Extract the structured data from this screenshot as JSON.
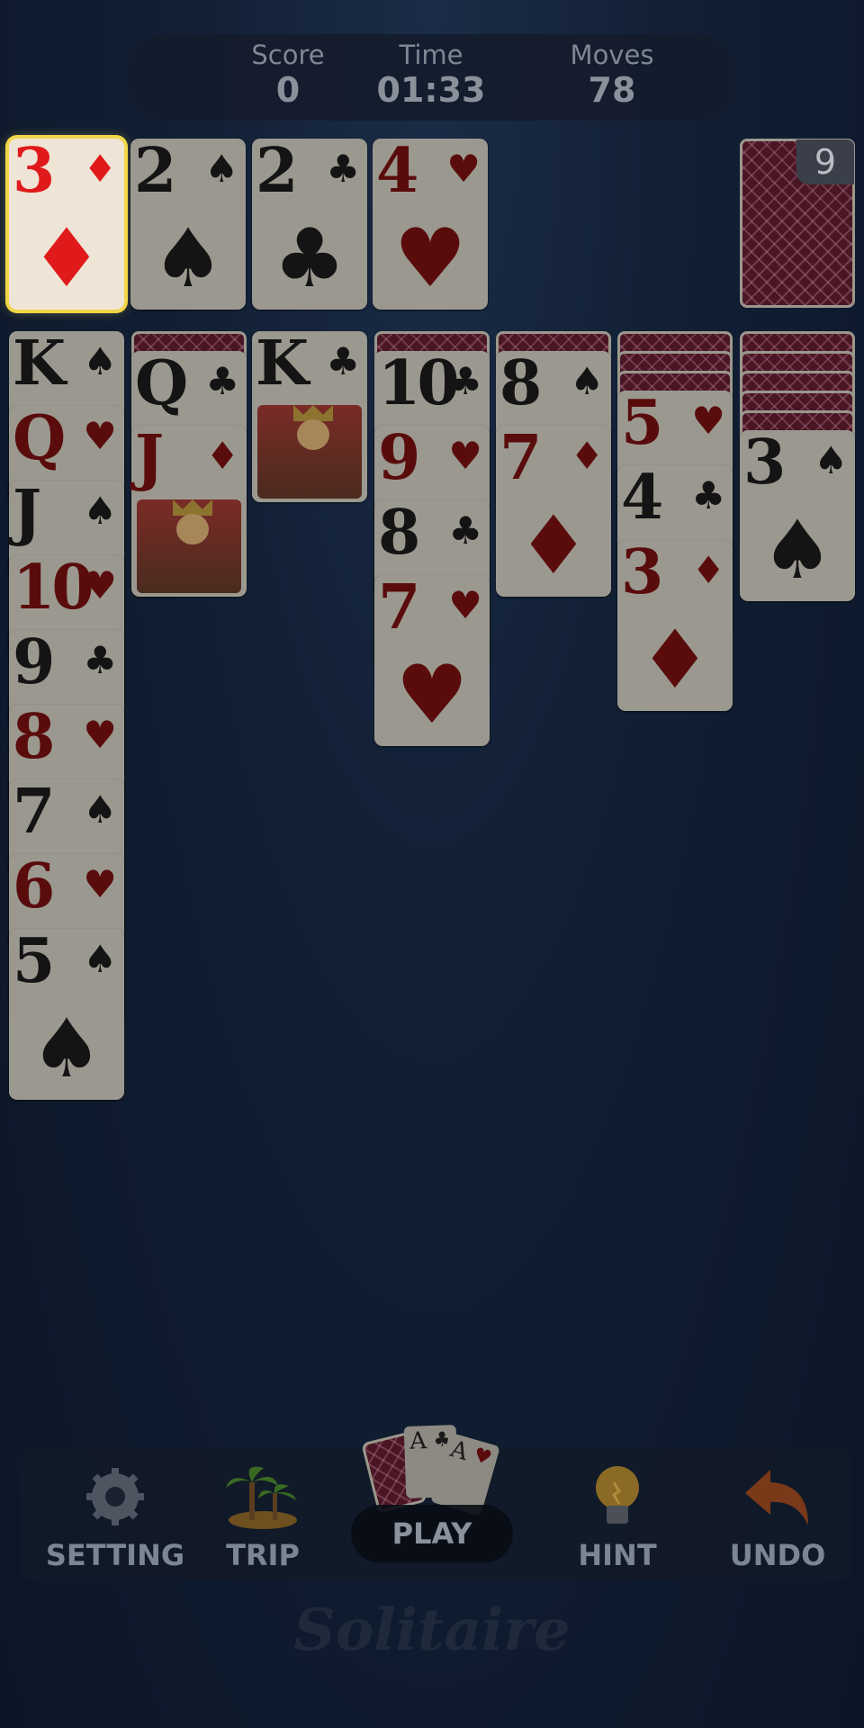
{
  "hud": {
    "score_label": "Score",
    "score_value": "0",
    "time_label": "Time",
    "time_value": "01:33",
    "moves_label": "Moves",
    "moves_value": "78"
  },
  "stock": {
    "count": "9"
  },
  "foundation": [
    {
      "rank": "3",
      "suit": "♦",
      "color": "red",
      "highlighted": true
    },
    {
      "rank": "2",
      "suit": "♠",
      "color": "black"
    },
    {
      "rank": "2",
      "suit": "♣",
      "color": "black"
    },
    {
      "rank": "4",
      "suit": "♥",
      "color": "red"
    }
  ],
  "tableau": [
    {
      "hidden": 0,
      "cards": [
        {
          "rank": "K",
          "suit": "♠",
          "color": "black"
        },
        {
          "rank": "Q",
          "suit": "♥",
          "color": "red"
        },
        {
          "rank": "J",
          "suit": "♠",
          "color": "black"
        },
        {
          "rank": "10",
          "suit": "♥",
          "color": "red"
        },
        {
          "rank": "9",
          "suit": "♣",
          "color": "black"
        },
        {
          "rank": "8",
          "suit": "♥",
          "color": "red"
        },
        {
          "rank": "7",
          "suit": "♠",
          "color": "black"
        },
        {
          "rank": "6",
          "suit": "♥",
          "color": "red"
        },
        {
          "rank": "5",
          "suit": "♠",
          "color": "black"
        }
      ]
    },
    {
      "hidden": 1,
      "cards": [
        {
          "rank": "Q",
          "suit": "♣",
          "color": "black"
        },
        {
          "rank": "J",
          "suit": "♦",
          "color": "red",
          "face": true
        }
      ]
    },
    {
      "hidden": 0,
      "cards": [
        {
          "rank": "K",
          "suit": "♣",
          "color": "black",
          "face": true
        }
      ]
    },
    {
      "hidden": 1,
      "cards": [
        {
          "rank": "10",
          "suit": "♣",
          "color": "black"
        },
        {
          "rank": "9",
          "suit": "♥",
          "color": "red"
        },
        {
          "rank": "8",
          "suit": "♣",
          "color": "black"
        },
        {
          "rank": "7",
          "suit": "♥",
          "color": "red"
        }
      ]
    },
    {
      "hidden": 1,
      "cards": [
        {
          "rank": "8",
          "suit": "♠",
          "color": "black"
        },
        {
          "rank": "7",
          "suit": "♦",
          "color": "red"
        }
      ]
    },
    {
      "hidden": 3,
      "cards": [
        {
          "rank": "5",
          "suit": "♥",
          "color": "red"
        },
        {
          "rank": "4",
          "suit": "♣",
          "color": "black"
        },
        {
          "rank": "3",
          "suit": "♦",
          "color": "red"
        }
      ]
    },
    {
      "hidden": 5,
      "cards": [
        {
          "rank": "3",
          "suit": "♠",
          "color": "black"
        }
      ]
    }
  ],
  "toolbar": {
    "setting": "SETTING",
    "trip": "TRIP",
    "play": "PLAY",
    "hint": "HINT",
    "undo": "UNDO",
    "play_card_a1": "A",
    "play_card_a2": "A"
  },
  "icons": {
    "setting": "gear-wrench-icon",
    "trip": "palm-island-icon",
    "play": "cards-icon",
    "hint": "lightbulb-icon",
    "undo": "undo-arrow-icon"
  },
  "footer": {
    "logo": "Solitaire"
  },
  "colors": {
    "highlight": "#f2d64a",
    "red_suit": "#e01a1a",
    "card_back": "#4a1624"
  }
}
